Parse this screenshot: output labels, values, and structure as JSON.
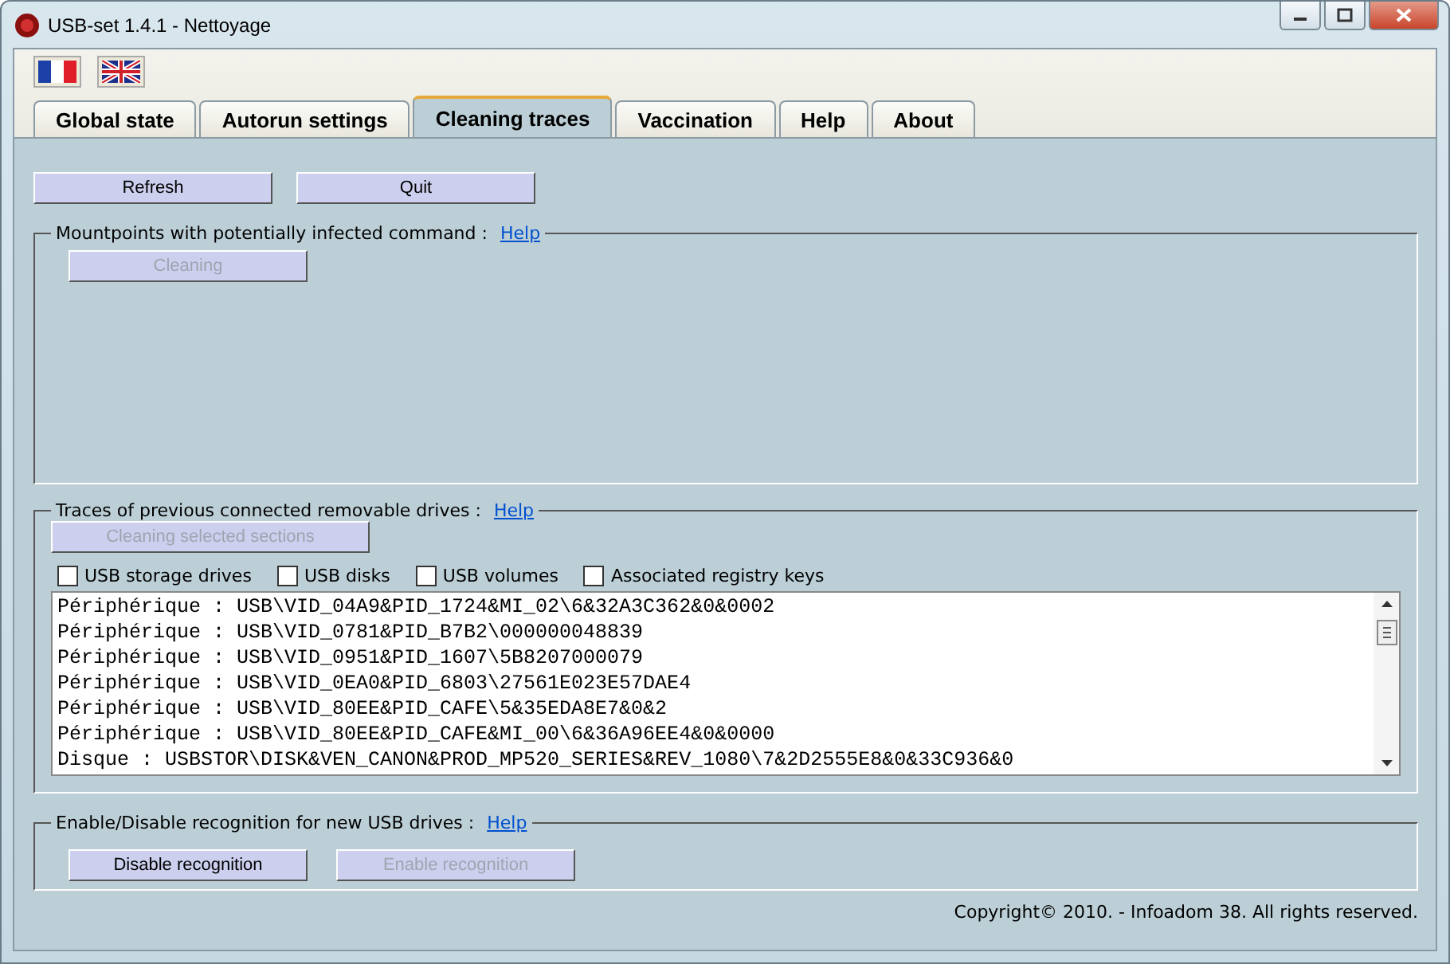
{
  "window": {
    "title": "USB-set 1.4.1 - Nettoyage"
  },
  "tabs": [
    {
      "label": "Global state",
      "selected": false
    },
    {
      "label": "Autorun settings",
      "selected": false
    },
    {
      "label": "Cleaning traces",
      "selected": true
    },
    {
      "label": "Vaccination",
      "selected": false
    },
    {
      "label": "Help",
      "selected": false
    },
    {
      "label": "About",
      "selected": false
    }
  ],
  "actions": [
    {
      "label": "Refresh",
      "disabled": false
    },
    {
      "label": "Quit",
      "disabled": false
    }
  ],
  "mountpoints": {
    "title": "Mountpoints with potentially infected command :",
    "help": "Help",
    "button": {
      "label": "Cleaning",
      "disabled": true
    }
  },
  "traces": {
    "title": "Traces of previous connected removable drives :",
    "help": "Help",
    "button": {
      "label": "Cleaning selected sections",
      "disabled": true
    },
    "filters": [
      {
        "label": "USB storage drives",
        "checked": false
      },
      {
        "label": "USB disks",
        "checked": false
      },
      {
        "label": "USB volumes",
        "checked": false
      },
      {
        "label": "Associated registry keys",
        "checked": false
      }
    ],
    "lines": [
      "Périphérique : USB\\VID_04A9&PID_1724&MI_02\\6&32A3C362&0&0002",
      "Périphérique : USB\\VID_0781&PID_B7B2\\000000048839",
      "Périphérique : USB\\VID_0951&PID_1607\\5B8207000079",
      "Périphérique : USB\\VID_0EA0&PID_6803\\27561E023E57DAE4",
      "Périphérique : USB\\VID_80EE&PID_CAFE\\5&35EDA8E7&0&2",
      "Périphérique : USB\\VID_80EE&PID_CAFE&MI_00\\6&36A96EE4&0&0000",
      "Disque : USBSTOR\\DISK&VEN_CANON&PROD_MP520_SERIES&REV_1080\\7&2D2555E8&0&33C936&0"
    ]
  },
  "recognition": {
    "title": "Enable/Disable recognition for new USB drives :",
    "help": "Help",
    "buttons": [
      {
        "label": "Disable recognition",
        "disabled": false
      },
      {
        "label": "Enable recognition",
        "disabled": true
      }
    ]
  },
  "status_bar": "Copyright© 2010. - Infoadom 38. All rights reserved."
}
